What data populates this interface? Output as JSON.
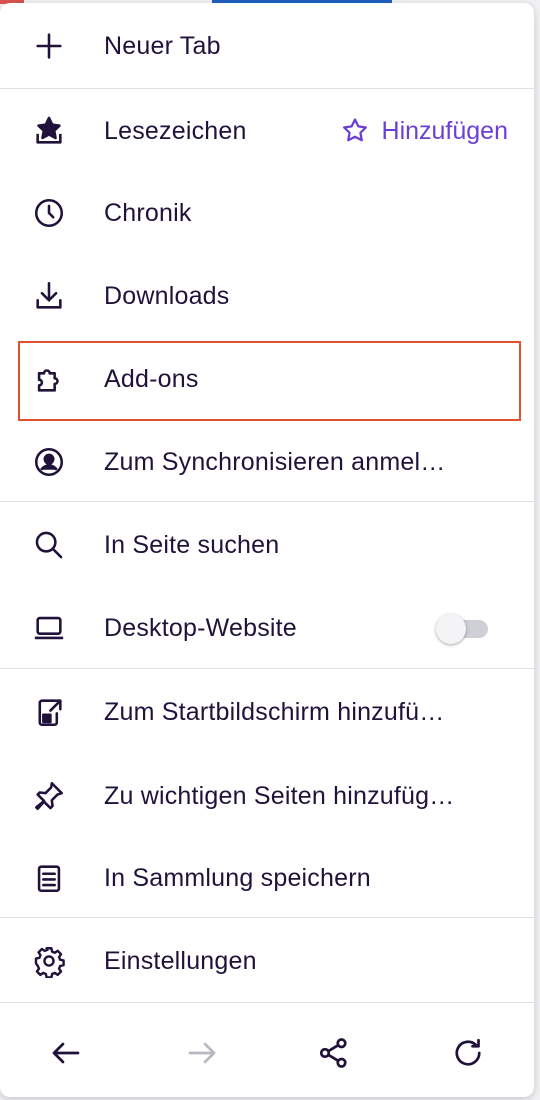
{
  "colors": {
    "text": "#20123a",
    "accent": "#6a3fd8",
    "highlight_border": "#e0502c",
    "disabled": "#b8b8c4"
  },
  "menu": {
    "new_tab": {
      "label": "Neuer Tab",
      "icon": "plus-icon"
    },
    "bookmarks": {
      "label": "Lesezeichen",
      "icon": "bookmark-star-icon",
      "action_label": "Hinzufügen",
      "action_icon": "star-outline-icon"
    },
    "history": {
      "label": "Chronik",
      "icon": "clock-icon"
    },
    "downloads": {
      "label": "Downloads",
      "icon": "download-icon"
    },
    "addons": {
      "label": "Add-ons",
      "icon": "puzzle-icon",
      "highlighted": true
    },
    "sync": {
      "label": "Zum Synchronisieren anmel…",
      "icon": "account-icon"
    },
    "find_in_page": {
      "label": "In Seite suchen",
      "icon": "search-icon"
    },
    "desktop_site": {
      "label": "Desktop-Website",
      "icon": "laptop-icon",
      "toggle_on": false
    },
    "add_to_home": {
      "label": "Zum Startbildschirm hinzufü…",
      "icon": "add-to-homescreen-icon"
    },
    "top_sites": {
      "label": "Zu wichtigen Seiten hinzufüg…",
      "icon": "pin-icon"
    },
    "collection": {
      "label": "In Sammlung speichern",
      "icon": "collection-icon"
    },
    "settings": {
      "label": "Einstellungen",
      "icon": "gear-icon"
    }
  },
  "bottom_bar": {
    "back": {
      "icon": "back-arrow-icon",
      "enabled": true
    },
    "forward": {
      "icon": "forward-arrow-icon",
      "enabled": false
    },
    "share": {
      "icon": "share-icon",
      "enabled": true
    },
    "reload": {
      "icon": "reload-icon",
      "enabled": true
    }
  }
}
